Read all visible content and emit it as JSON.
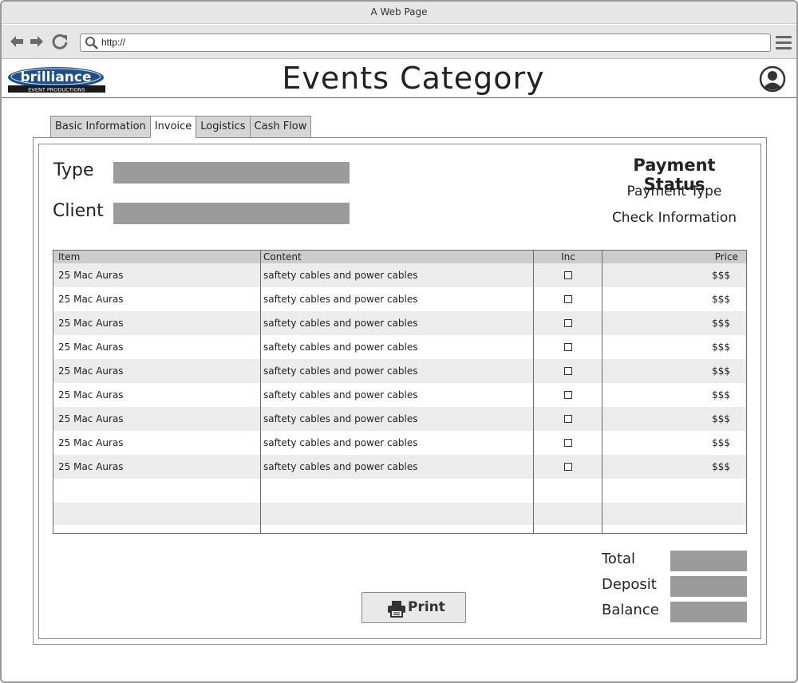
{
  "window": {
    "title": "A Web Page"
  },
  "browser": {
    "url": "http://"
  },
  "header": {
    "title": "Events Category",
    "logo_text": "brilliance",
    "logo_subtext": "EVENT PRODUCTIONS"
  },
  "tabs": [
    {
      "label": "Basic Information",
      "active": false
    },
    {
      "label": "Invoice",
      "active": true
    },
    {
      "label": "Logistics",
      "active": false
    },
    {
      "label": "Cash Flow",
      "active": false
    }
  ],
  "form": {
    "type_label": "Type",
    "client_label": "Client"
  },
  "payment": {
    "status_title": "Payment Status",
    "type_label": "Payment Type",
    "check_label": "Check Information"
  },
  "table": {
    "columns": {
      "item": "Item",
      "content": "Content",
      "inc": "Inc",
      "price": "Price"
    },
    "rows": [
      {
        "item": "25 Mac Auras",
        "content": "saftety cables and power cables",
        "inc": false,
        "price": "$$$"
      },
      {
        "item": "25 Mac Auras",
        "content": "saftety cables and power cables",
        "inc": false,
        "price": "$$$"
      },
      {
        "item": "25 Mac Auras",
        "content": "saftety cables and power cables",
        "inc": false,
        "price": "$$$"
      },
      {
        "item": "25 Mac Auras",
        "content": "saftety cables and power cables",
        "inc": false,
        "price": "$$$"
      },
      {
        "item": "25 Mac Auras",
        "content": "saftety cables and power cables",
        "inc": false,
        "price": "$$$"
      },
      {
        "item": "25 Mac Auras",
        "content": "saftety cables and power cables",
        "inc": false,
        "price": "$$$"
      },
      {
        "item": "25 Mac Auras",
        "content": "saftety cables and power cables",
        "inc": false,
        "price": "$$$"
      },
      {
        "item": "25 Mac Auras",
        "content": "saftety cables and power cables",
        "inc": false,
        "price": "$$$"
      },
      {
        "item": "25 Mac Auras",
        "content": "saftety cables and power cables",
        "inc": false,
        "price": "$$$"
      }
    ]
  },
  "totals": {
    "total_label": "Total",
    "deposit_label": "Deposit",
    "balance_label": "Balance"
  },
  "actions": {
    "print_label": "Print"
  },
  "icons": {
    "back": "back-arrow-icon",
    "forward": "forward-arrow-icon",
    "reload": "reload-icon",
    "search": "search-icon",
    "menu": "hamburger-menu-icon",
    "user": "user-avatar-icon",
    "print": "printer-icon"
  }
}
